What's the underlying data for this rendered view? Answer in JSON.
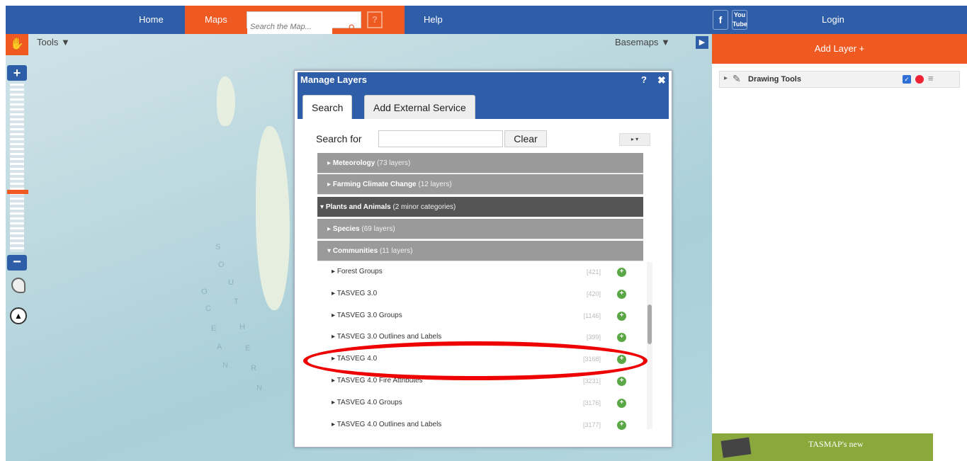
{
  "nav": {
    "home": "Home",
    "maps": "Maps",
    "search_placeholder": "Search the Map...",
    "search_icon": "search-icon",
    "help_box": "?",
    "help": "Help",
    "facebook": "f",
    "youtube": "You Tube",
    "login": "Login"
  },
  "map": {
    "tools": "Tools ▼",
    "basemaps": "Basemaps ▼",
    "zoom_in": "+",
    "zoom_out": "−",
    "ocean_label": [
      "S",
      "O",
      "U",
      "T",
      "H",
      "E",
      "R",
      "N",
      "O",
      "C",
      "E",
      "A",
      "N"
    ]
  },
  "right_panel": {
    "add_layer": "Add Layer +",
    "drawing_tools": "Drawing Tools",
    "ad_text": "TASMAP's new"
  },
  "dialog": {
    "title": "Manage Layers",
    "help": "?",
    "close": "✖",
    "tabs": [
      "Search",
      "Add External Service"
    ],
    "search_for": "Search for",
    "clear": "Clear",
    "categories": [
      {
        "name": "Meteorology",
        "count": "(73 layers)",
        "style": "light"
      },
      {
        "name": "Farming Climate Change",
        "count": "(12 layers)",
        "style": "light"
      },
      {
        "name": "Plants and Animals",
        "count": "(2 minor categories)",
        "style": "dark"
      },
      {
        "name": "Species",
        "count": "(69 layers)",
        "style": "light"
      },
      {
        "name": "Communities",
        "count": "(11 layers)",
        "style": "light"
      }
    ],
    "layers": [
      {
        "name": "Forest Groups",
        "id": "[421]"
      },
      {
        "name": "TASVEG 3.0",
        "id": "[420]"
      },
      {
        "name": "TASVEG 3.0 Groups",
        "id": "[1146]"
      },
      {
        "name": "TASVEG 3.0 Outlines and Labels",
        "id": "[399]"
      },
      {
        "name": "TASVEG 4.0",
        "id": "[3168]"
      },
      {
        "name": "TASVEG 4.0 Fire Attributes",
        "id": "[3231]"
      },
      {
        "name": "TASVEG 4.0 Groups",
        "id": "[3176]"
      },
      {
        "name": "TASVEG 4.0 Outlines and Labels",
        "id": "[3177]"
      }
    ]
  },
  "colors": {
    "nav_blue": "#2f5ea9",
    "accent_orange": "#ef5a22",
    "highlight_red": "#e00000"
  }
}
